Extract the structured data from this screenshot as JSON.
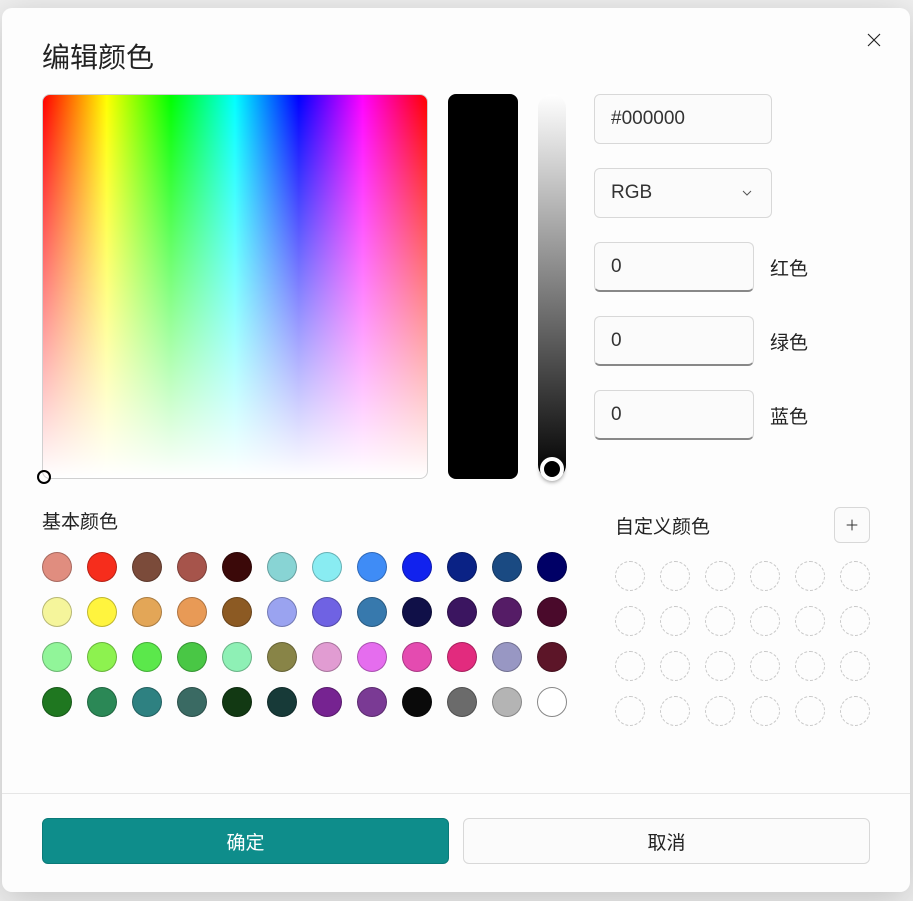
{
  "title": "编辑颜色",
  "hex_value": "#000000",
  "color_model": "RGB",
  "channels": {
    "red": {
      "label": "红色",
      "value": "0"
    },
    "green": {
      "label": "绿色",
      "value": "0"
    },
    "blue": {
      "label": "蓝色",
      "value": "0"
    }
  },
  "preview_color": "#000000",
  "basic_colors_label": "基本颜色",
  "custom_colors_label": "自定义颜色",
  "basic_colors": [
    "#e08d7f",
    "#f62d1c",
    "#7b4b3a",
    "#a6544b",
    "#3b0909",
    "#88d4d4",
    "#89ecf2",
    "#3f8cf6",
    "#1122ee",
    "#0a2285",
    "#1a4a82",
    "#000066",
    "#f5f59b",
    "#fff43e",
    "#e3a657",
    "#e89a56",
    "#8c5a23",
    "#9aa3f0",
    "#6f62e3",
    "#3779ad",
    "#101048",
    "#3b1560",
    "#551c66",
    "#4a0a2b",
    "#91f599",
    "#8df24f",
    "#5be84b",
    "#49c745",
    "#8ef0b5",
    "#888447",
    "#e19cd2",
    "#e56dee",
    "#e44bb0",
    "#e22b7e",
    "#9897c3",
    "#5c1528",
    "#1f7720",
    "#2b8856",
    "#2e8181",
    "#3a6a63",
    "#123913",
    "#173a38",
    "#762391",
    "#7a3a94",
    "#0a0a0a",
    "#6b6b6b",
    "#b4b4b4",
    "#ffffff"
  ],
  "custom_color_slots": 24,
  "buttons": {
    "ok": "确定",
    "cancel": "取消"
  }
}
